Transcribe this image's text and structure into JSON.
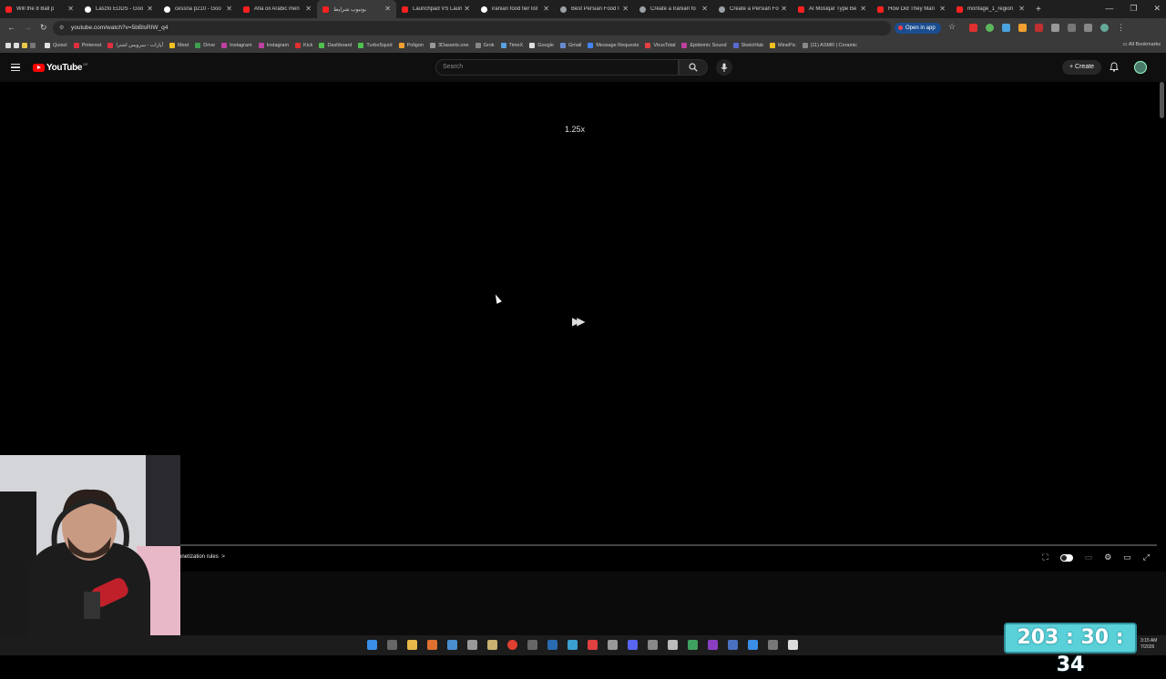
{
  "browser": {
    "tabs": [
      {
        "title": "Will the 8 Ball p",
        "icon": "youtube-icon"
      },
      {
        "title": "Laszlo EDDS - Goo",
        "icon": "google-icon"
      },
      {
        "title": "cessna p210 - Goo",
        "icon": "google-icon"
      },
      {
        "title": "Afia oil Arabic men",
        "icon": "youtube-icon"
      },
      {
        "title": "یوتیوب شرایط",
        "icon": "youtube-icon",
        "active": true
      },
      {
        "title": "Launchpad VS Laun",
        "icon": "youtube-icon"
      },
      {
        "title": "iranian food tier list",
        "icon": "google-icon"
      },
      {
        "title": "Best Persian Food I",
        "icon": "web-icon"
      },
      {
        "title": "Create a Iranian fo",
        "icon": "web-icon"
      },
      {
        "title": "Create a Persian Fo",
        "icon": "web-icon"
      },
      {
        "title": "AI Mosiqar Type Be",
        "icon": "youtube-icon"
      },
      {
        "title": "How Did They Man",
        "icon": "youtube-icon"
      },
      {
        "title": "montage_1_region",
        "icon": "youtube-icon"
      }
    ],
    "url": "youtube.com/watch?v=5bBlsRIW_q4",
    "open_in_app": "Open in app",
    "bookmarks": [
      "Quixel",
      "Pinterest",
      "آپارات - سرویس اشترا",
      "Meet",
      "Drive",
      "Instagram",
      "Instagram",
      "Kick",
      "Dashboard",
      "TurboSquid",
      "Poligon",
      "3Dassets.one",
      "Grok",
      "TimeX",
      "Google",
      "Gmail",
      "Message Requests",
      "VirusTotal",
      "Epidemic Sound",
      "Sketchfab",
      "MinePic",
      "(11) ASMR | Ceramic"
    ],
    "all_bookmarks": "All Bookmarks"
  },
  "youtube": {
    "logo_text": "YouTube",
    "country_code": "DE",
    "search_placeholder": "Search",
    "create_label": "Create"
  },
  "player": {
    "speed_label": "1.25x",
    "monetization_text": "onetization rules",
    "monetization_arrow": ">"
  },
  "stream": {
    "timer": "203 : 30 : 34"
  },
  "taskbar": {
    "clock_time": "3:15 AM",
    "clock_date": "7/2026"
  }
}
